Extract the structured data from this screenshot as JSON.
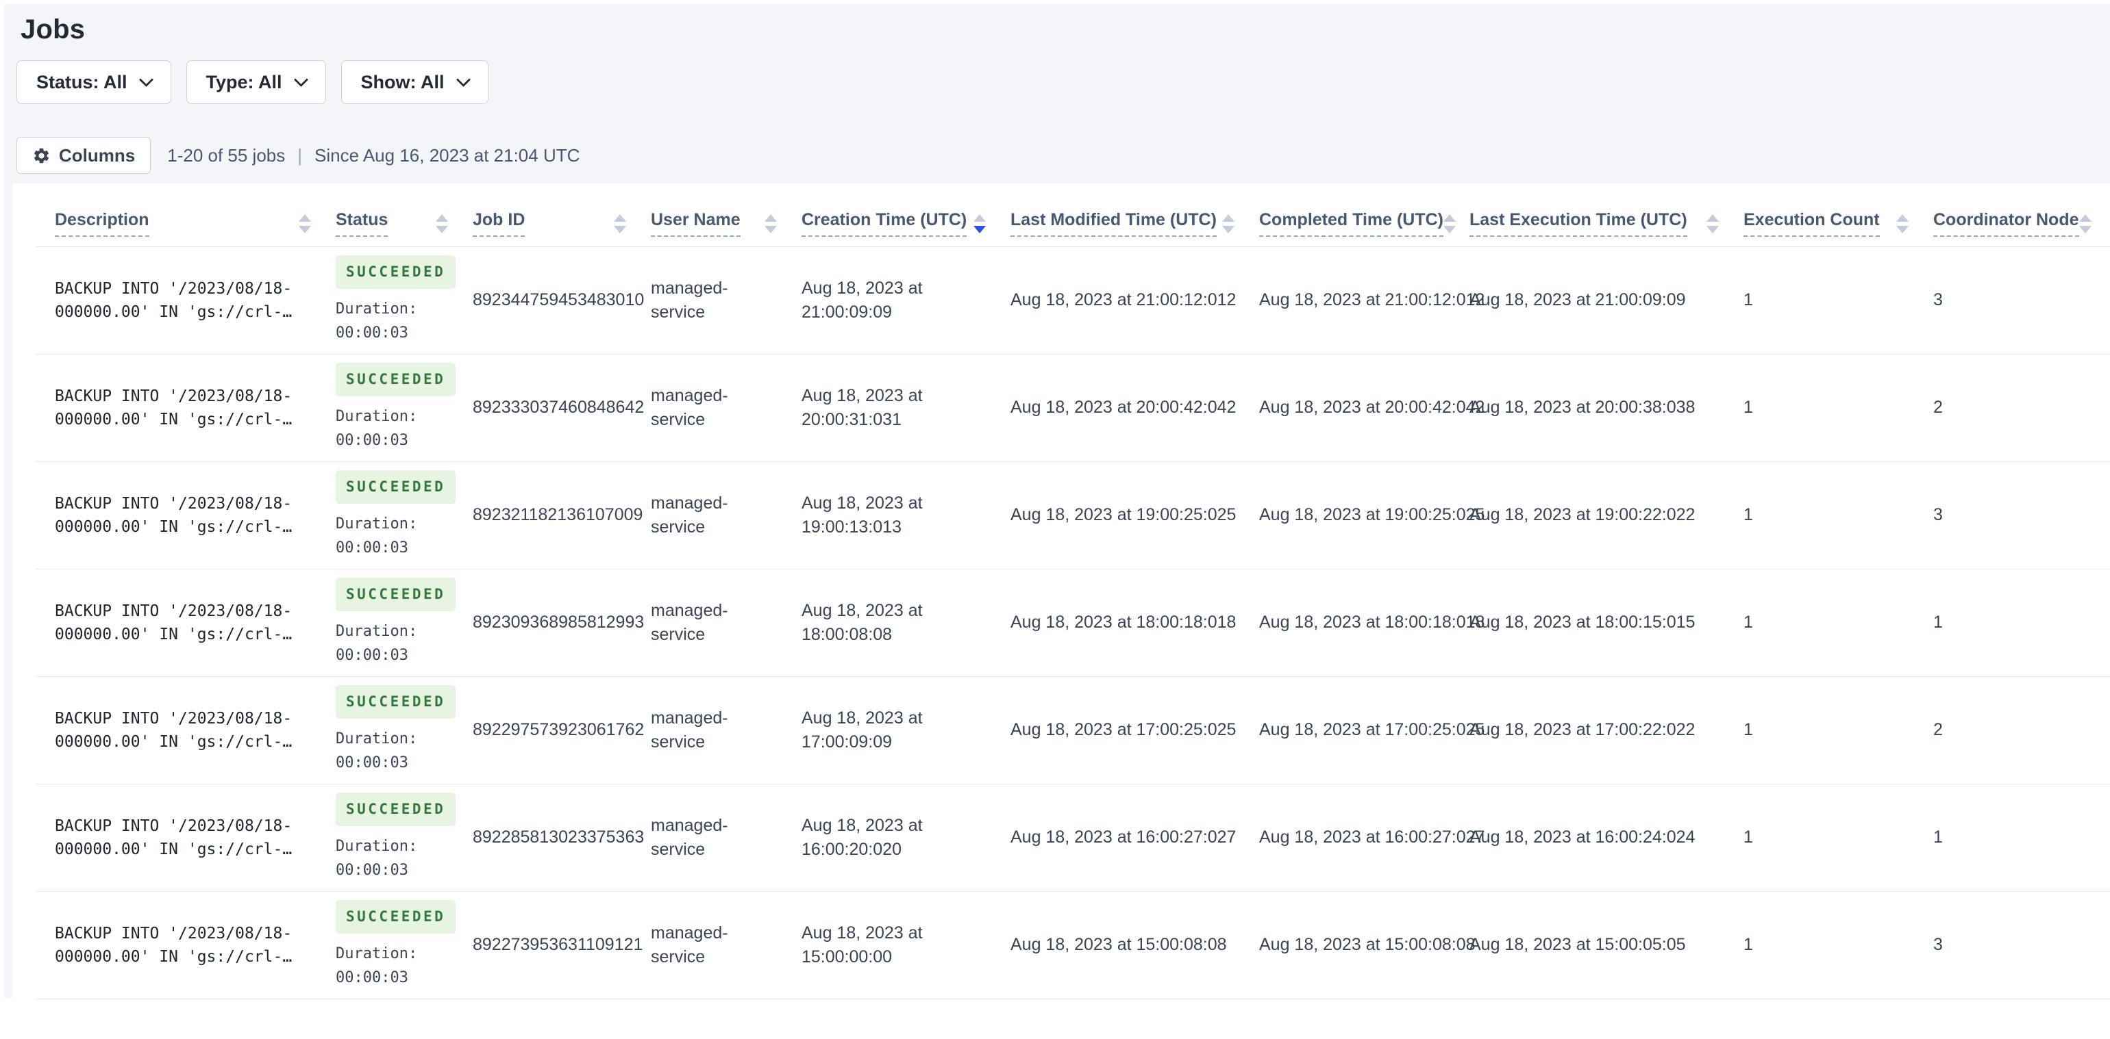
{
  "title": "Jobs",
  "filters": [
    {
      "label": "Status: All"
    },
    {
      "label": "Type: All"
    },
    {
      "label": "Show: All"
    }
  ],
  "toolbar": {
    "columns_label": "Columns",
    "count_text": "1-20 of 55 jobs",
    "divider": "|",
    "since_text": "Since Aug 16, 2023 at 21:04 UTC"
  },
  "icons": {
    "gear": "gear-icon",
    "chevron": "chevron-down-icon"
  },
  "colors": {
    "accent_blue": "#2b55e6",
    "success_text": "#317a3c",
    "success_bg": "#e7f4e1",
    "page_background": "#f4f5f9"
  },
  "table": {
    "sorted_column": "Creation Time (UTC)",
    "sort_direction": "desc",
    "columns": [
      {
        "label": "Description",
        "sort": "none"
      },
      {
        "label": "Status",
        "sort": "none"
      },
      {
        "label": "Job ID",
        "sort": "none"
      },
      {
        "label": "User Name",
        "sort": "none"
      },
      {
        "label": "Creation Time (UTC)",
        "sort": "desc"
      },
      {
        "label": "Last Modified Time (UTC)",
        "sort": "none"
      },
      {
        "label": "Completed Time (UTC)",
        "sort": "none"
      },
      {
        "label": "Last Execution Time (UTC)",
        "sort": "none"
      },
      {
        "label": "Execution Count",
        "sort": "none"
      },
      {
        "label": "Coordinator Node",
        "sort": "none"
      }
    ],
    "rows": [
      {
        "description": "BACKUP INTO '/2023/08/18-\n000000.00' IN 'gs://crl-…",
        "status": "SUCCEEDED",
        "duration_label": "Duration:",
        "duration": "00:00:03",
        "job_id": "892344759453483010",
        "user_name": "managed-service",
        "creation_time": "Aug 18, 2023 at 21:00:09:09",
        "last_modified": "Aug 18, 2023 at 21:00:12:012",
        "completed_time": "Aug 18, 2023 at 21:00:12:012",
        "last_execution": "Aug 18, 2023 at 21:00:09:09",
        "execution_count": "1",
        "coordinator_node": "3"
      },
      {
        "description": "BACKUP INTO '/2023/08/18-\n000000.00' IN 'gs://crl-…",
        "status": "SUCCEEDED",
        "duration_label": "Duration:",
        "duration": "00:00:03",
        "job_id": "892333037460848642",
        "user_name": "managed-service",
        "creation_time": "Aug 18, 2023 at 20:00:31:031",
        "last_modified": "Aug 18, 2023 at 20:00:42:042",
        "completed_time": "Aug 18, 2023 at 20:00:42:042",
        "last_execution": "Aug 18, 2023 at 20:00:38:038",
        "execution_count": "1",
        "coordinator_node": "2"
      },
      {
        "description": "BACKUP INTO '/2023/08/18-\n000000.00' IN 'gs://crl-…",
        "status": "SUCCEEDED",
        "duration_label": "Duration:",
        "duration": "00:00:03",
        "job_id": "892321182136107009",
        "user_name": "managed-service",
        "creation_time": "Aug 18, 2023 at 19:00:13:013",
        "last_modified": "Aug 18, 2023 at 19:00:25:025",
        "completed_time": "Aug 18, 2023 at 19:00:25:025",
        "last_execution": "Aug 18, 2023 at 19:00:22:022",
        "execution_count": "1",
        "coordinator_node": "3"
      },
      {
        "description": "BACKUP INTO '/2023/08/18-\n000000.00' IN 'gs://crl-…",
        "status": "SUCCEEDED",
        "duration_label": "Duration:",
        "duration": "00:00:03",
        "job_id": "892309368985812993",
        "user_name": "managed-service",
        "creation_time": "Aug 18, 2023 at 18:00:08:08",
        "last_modified": "Aug 18, 2023 at 18:00:18:018",
        "completed_time": "Aug 18, 2023 at 18:00:18:018",
        "last_execution": "Aug 18, 2023 at 18:00:15:015",
        "execution_count": "1",
        "coordinator_node": "1"
      },
      {
        "description": "BACKUP INTO '/2023/08/18-\n000000.00' IN 'gs://crl-…",
        "status": "SUCCEEDED",
        "duration_label": "Duration:",
        "duration": "00:00:03",
        "job_id": "892297573923061762",
        "user_name": "managed-service",
        "creation_time": "Aug 18, 2023 at 17:00:09:09",
        "last_modified": "Aug 18, 2023 at 17:00:25:025",
        "completed_time": "Aug 18, 2023 at 17:00:25:025",
        "last_execution": "Aug 18, 2023 at 17:00:22:022",
        "execution_count": "1",
        "coordinator_node": "2"
      },
      {
        "description": "BACKUP INTO '/2023/08/18-\n000000.00' IN 'gs://crl-…",
        "status": "SUCCEEDED",
        "duration_label": "Duration:",
        "duration": "00:00:03",
        "job_id": "892285813023375363",
        "user_name": "managed-service",
        "creation_time": "Aug 18, 2023 at 16:00:20:020",
        "last_modified": "Aug 18, 2023 at 16:00:27:027",
        "completed_time": "Aug 18, 2023 at 16:00:27:027",
        "last_execution": "Aug 18, 2023 at 16:00:24:024",
        "execution_count": "1",
        "coordinator_node": "1"
      },
      {
        "description": "BACKUP INTO '/2023/08/18-\n000000.00' IN 'gs://crl-…",
        "status": "SUCCEEDED",
        "duration_label": "Duration:",
        "duration": "00:00:03",
        "job_id": "892273953631109121",
        "user_name": "managed-service",
        "creation_time": "Aug 18, 2023 at 15:00:00:00",
        "last_modified": "Aug 18, 2023 at 15:00:08:08",
        "completed_time": "Aug 18, 2023 at 15:00:08:08",
        "last_execution": "Aug 18, 2023 at 15:00:05:05",
        "execution_count": "1",
        "coordinator_node": "3"
      }
    ]
  }
}
